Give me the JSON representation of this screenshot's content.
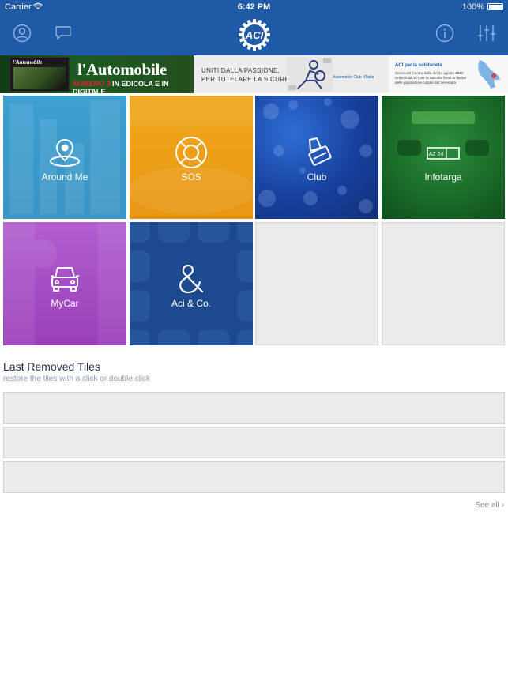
{
  "status_bar": {
    "carrier": "Carrier",
    "time": "6:42 PM",
    "battery": "100%"
  },
  "header": {
    "background": "#1f5aa6",
    "left_icons": [
      "user-icon",
      "chat-bubble-icon"
    ],
    "logo": "ACI",
    "right_icons": [
      "info-icon",
      "sliders-icon"
    ]
  },
  "banners": {
    "magazine": {
      "cover_title": "l'Automobile",
      "title": "l'Automobile",
      "subtitle_red": "NUMERO 3",
      "subtitle_rest": " IN EDICOLA E IN DIGITALE"
    },
    "campaign": {
      "slogan": "UNITI DALLA PASSIONE,\nPER TUTELARE LA SICUREZZA.",
      "org": "Automobile Club d'Italia"
    },
    "solidarity": {
      "title": "ACI per la solidarietà",
      "body": "Sisma del Centro Italia del 24 agosto 2016 Unisciti ad ACI per la raccolta fondi in favore delle popolazioni colpite dal terremoto"
    }
  },
  "tiles": [
    {
      "label": "Around Me",
      "icon": "location-pin-icon",
      "color": "#3b9bcc"
    },
    {
      "label": "SOS",
      "icon": "lifebuoy-icon",
      "color": "#eca01a"
    },
    {
      "label": "Club",
      "icon": "membership-card-icon",
      "color": "#173f9c"
    },
    {
      "label": "Infotarga",
      "icon": "license-plate-icon",
      "plate_text": "AZ 24",
      "color": "#1a6a28"
    },
    {
      "label": "MyCar",
      "icon": "car-icon",
      "color": "#a64ec4"
    },
    {
      "label": "Aci & Co.",
      "icon": "ampersand-icon",
      "color": "#1d4a8e"
    }
  ],
  "removed_section": {
    "title": "Last Removed Tiles",
    "subtitle": "restore the tiles with a click or double click",
    "slots": 3,
    "see_all": "See all ›"
  }
}
